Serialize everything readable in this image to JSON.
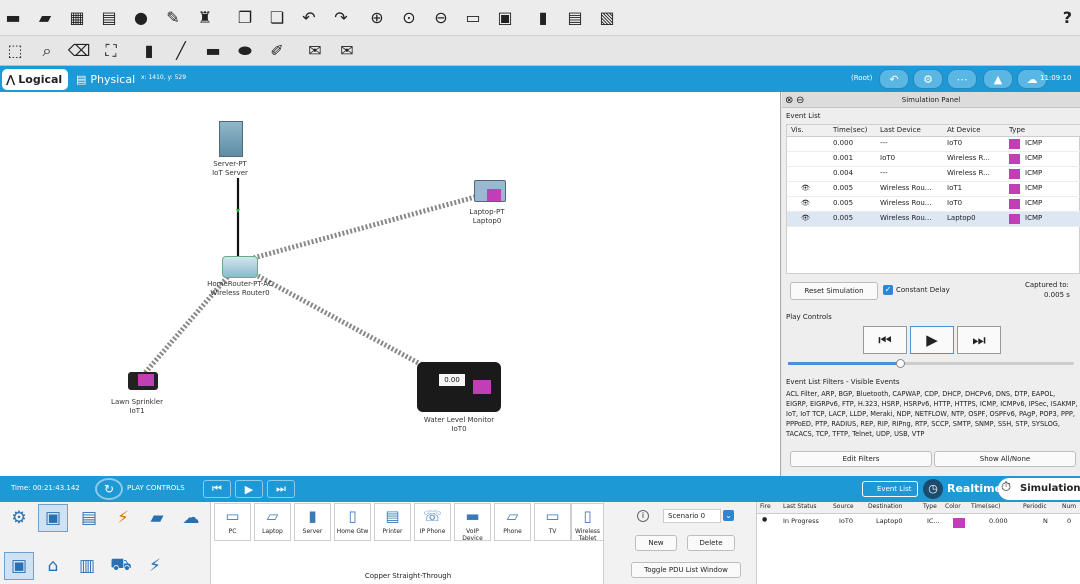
{
  "toolbar": {
    "icons": [
      "new-file",
      "open-folder",
      "save",
      "print",
      "info",
      "activity-wizard",
      "custom-device",
      "copy",
      "paste",
      "undo",
      "redo",
      "zoom-in",
      "zoom-reset",
      "zoom-out",
      "palette",
      "custom-devices-dialog",
      "viewport",
      "ipc",
      "screenshot"
    ],
    "help": "?"
  },
  "toolbar2": {
    "icons": [
      "select",
      "inspect",
      "delete",
      "resize",
      "note",
      "line",
      "rectangle",
      "ellipse",
      "freeform",
      "add-simple-pdu",
      "add-complex-pdu"
    ]
  },
  "workspace": {
    "logical_tab": "Logical",
    "physical_tab": "Physical",
    "coordinates": "x: 1410, y: 529",
    "root": "(Root)",
    "clock": "11:09:10"
  },
  "devices": {
    "server": {
      "line1": "Server-PT",
      "line2": "IoT Server"
    },
    "router": {
      "line1": "HomeRouter-PT-AC",
      "line2": "Wireless Router0"
    },
    "laptop": {
      "line1": "Laptop-PT",
      "line2": "Laptop0"
    },
    "sprinkler": {
      "line1": "Lawn Sprinkler",
      "line2": "IoT1"
    },
    "monitor": {
      "line1": "Water Level Monitor",
      "line2": "IoT0",
      "screen_value": "0.00"
    }
  },
  "simulation_panel": {
    "title": "Simulation Panel",
    "event_list_label": "Event List",
    "columns": [
      "Vis.",
      "Time(sec)",
      "Last Device",
      "At Device",
      "Type"
    ],
    "rows": [
      {
        "vis": "",
        "time": "0.000",
        "last": "---",
        "at": "IoT0",
        "type": "ICMP"
      },
      {
        "vis": "",
        "time": "0.001",
        "last": "IoT0",
        "at": "Wireless R...",
        "type": "ICMP"
      },
      {
        "vis": "",
        "time": "0.004",
        "last": "---",
        "at": "Wireless R...",
        "type": "ICMP"
      },
      {
        "vis": "👁",
        "time": "0.005",
        "last": "Wireless Rou...",
        "at": "IoT1",
        "type": "ICMP"
      },
      {
        "vis": "👁",
        "time": "0.005",
        "last": "Wireless Rou...",
        "at": "IoT0",
        "type": "ICMP"
      },
      {
        "vis": "👁",
        "time": "0.005",
        "last": "Wireless Rou...",
        "at": "Laptop0",
        "type": "ICMP"
      }
    ],
    "icmp_color": "#c13fb6",
    "reset_label": "Reset Simulation",
    "constant_delay_label": "Constant Delay",
    "captured_label": "Captured to:",
    "captured_value": "0.005 s",
    "play_controls_label": "Play Controls",
    "playback_speed": 0.39,
    "filters_title": "Event List Filters - Visible Events",
    "filters_text": "ACL Filter, ARP, BGP, Bluetooth, CAPWAP, CDP, DHCP, DHCPv6, DNS, DTP, EAPOL, EIGRP, EIGRPv6, FTP, H.323, HSRP, HSRPv6, HTTP, HTTPS, ICMP, ICMPv6, IPSec, ISAKMP, IoT, IoT TCP, LACP, LLDP, Meraki, NDP, NETFLOW, NTP, OSPF, OSPFv6, PAgP, POP3, PPP, PPPoED, PTP, RADIUS, REP, RIP, RIPng, RTP, SCCP, SMTP, SNMP, SSH, STP, SYSLOG, TACACS, TCP, TFTP, Telnet, UDP, USB, VTP",
    "edit_filters": "Edit Filters",
    "show_all": "Show All/None"
  },
  "timebar": {
    "time": "Time: 00:21:43.142",
    "play_controls": "PLAY CONTROLS",
    "event_list": "Event List",
    "realtime": "Realtime",
    "simulation": "Simulation"
  },
  "device_palette": {
    "devices": [
      "PC",
      "Laptop",
      "Server",
      "Home Gtw",
      "Printer",
      "IP Phone",
      "VoIP Device",
      "Phone",
      "TV",
      "Wireless Tablet"
    ],
    "connection_label": "Copper Straight-Through"
  },
  "scenario": {
    "icon": "i",
    "name": "Scenario 0",
    "new": "New",
    "delete": "Delete",
    "toggle": "Toggle PDU List Window"
  },
  "pdu_list": {
    "columns": [
      "Fire",
      "Last Status",
      "Source",
      "Destination",
      "Type",
      "Color",
      "Time(sec)",
      "Periodic",
      "Num"
    ],
    "row": {
      "fire": "●",
      "status": "In Progress",
      "source": "IoT0",
      "destination": "Laptop0",
      "type": "IC...",
      "time": "0.000",
      "periodic": "N",
      "num": "0"
    },
    "color": "#c13fb6"
  }
}
